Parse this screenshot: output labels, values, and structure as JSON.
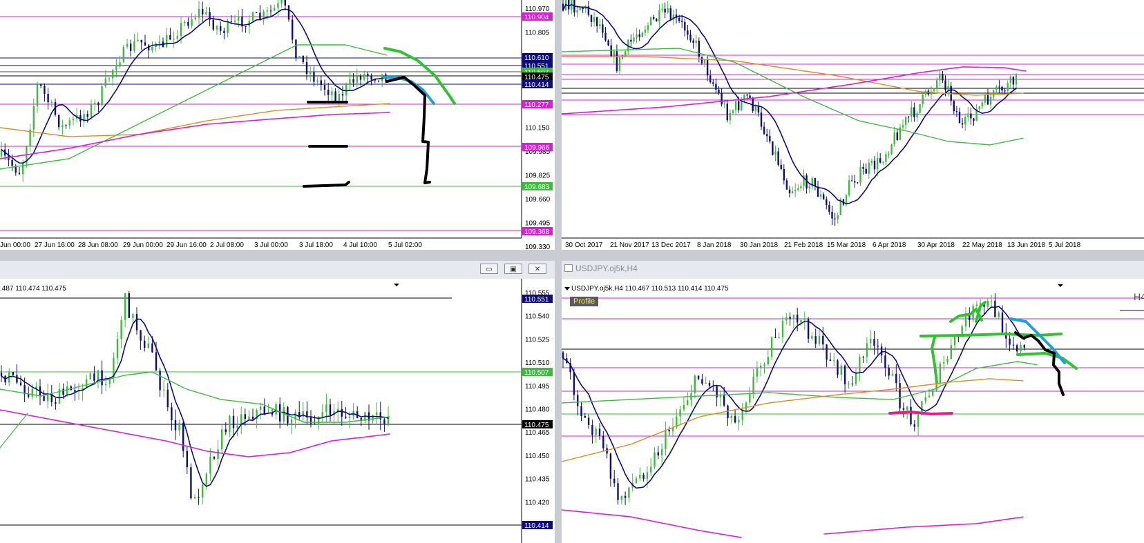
{
  "colors": {
    "green": "#3dbb3d",
    "navy": "#0b0b82",
    "magenta": "#d81ed8",
    "orange": "#e08b1f",
    "brush_green": "#2ec42e",
    "brush_blue": "#1ea0d8",
    "brush_pink": "#e61f86",
    "black": "#000000"
  },
  "topleft": {
    "price_labels": [
      "110.970",
      "110.805",
      "110.640",
      "110.475",
      "110.315",
      "110.150",
      "109.985",
      "109.825",
      "109.660",
      "109.495",
      "109.330"
    ],
    "tags": [
      {
        "text": "110.904",
        "color": "#d81ed8"
      },
      {
        "text": "110.610",
        "color": "#0b0b82"
      },
      {
        "text": "110.551",
        "color": "#0b0b82"
      },
      {
        "text": "110.507",
        "color": "#3dbb3d"
      },
      {
        "text": "110.475",
        "color": "#000000"
      },
      {
        "text": "110.414",
        "color": "#0b0b82"
      },
      {
        "text": "110.277",
        "color": "#d81ed8"
      },
      {
        "text": "109.966",
        "color": "#d81ed8"
      },
      {
        "text": "109.683",
        "color": "#3dbb3d"
      },
      {
        "text": "109.368",
        "color": "#d81ed8"
      }
    ],
    "time_labels": [
      "Jun 00:00",
      "27 Jun 16:00",
      "28 Jun 08:00",
      "29 Jun 00:00",
      "29 Jun 16:00",
      "2 Jul 08:00",
      "3 Jul 00:00",
      "3 Jul 18:00",
      "4 Jul 10:00",
      "5 Jul 02:00"
    ]
  },
  "topright": {
    "time_labels": [
      "30 Oct 2017",
      "21 Nov 2017",
      "13 Dec 2017",
      "8 Jan 2018",
      "30 Jan 2018",
      "21 Feb 2018",
      "15 Mar 2018",
      "6 Apr 2018",
      "30 Apr 2018",
      "22 May 2018",
      "13 Jun 2018",
      "5 Jul 2018"
    ]
  },
  "bottomleft": {
    "header": ".487 110.474 110.475",
    "window_buttons": [
      "▭",
      "▣",
      "✕"
    ],
    "price_labels": [
      "110.555",
      "110.540",
      "110.525",
      "110.510",
      "110.495",
      "110.480",
      "110.465",
      "110.450",
      "110.435",
      "110.420",
      "110.405"
    ],
    "tags": [
      {
        "text": "110.551",
        "color": "#0b0b82"
      },
      {
        "text": "110.507",
        "color": "#3dbb3d"
      },
      {
        "text": "110.475",
        "color": "#000000"
      },
      {
        "text": "110.414",
        "color": "#0b0b82"
      }
    ]
  },
  "bottomright": {
    "window_title": "USDJPY.oj5k,H4",
    "header": "USDJPY.oj5k,H4  110.467 110.513 110.414 110.475",
    "profile_label": "Profile",
    "corner_label": "H4"
  }
}
